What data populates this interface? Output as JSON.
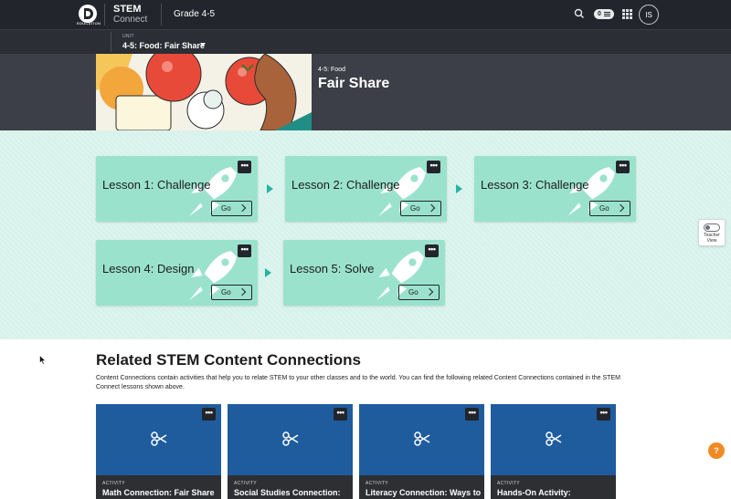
{
  "header": {
    "logo_text": "EDUCATION",
    "brand_primary": "STEM",
    "brand_secondary": "Connect",
    "grade": "Grade 4-5",
    "counter": "0",
    "avatar_initials": "IS"
  },
  "unit": {
    "label": "UNIT",
    "value": "4-5: Food: Fair Share"
  },
  "hero": {
    "kicker": "4-5: Food",
    "title": "Fair Share"
  },
  "lessons": [
    {
      "title": "Lesson 1: Challenge",
      "go": "Go"
    },
    {
      "title": "Lesson 2: Challenge",
      "go": "Go"
    },
    {
      "title": "Lesson 3: Challenge",
      "go": "Go"
    },
    {
      "title": "Lesson 4: Design",
      "go": "Go"
    },
    {
      "title": "Lesson 5: Solve",
      "go": "Go"
    }
  ],
  "teacher_view": {
    "line1": "Teacher",
    "line2": "View"
  },
  "related": {
    "title": "Related STEM Content Connections",
    "description": "Content Connections contain activities that help you to relate STEM to your other classes and to the world. You can find the following related Content Connections contained in the STEM Connect lessons shown above.",
    "cards": [
      {
        "kind": "ACTIVITY",
        "name": "Math Connection: Fair Share"
      },
      {
        "kind": "ACTIVITY",
        "name": "Social Studies Connection:"
      },
      {
        "kind": "ACTIVITY",
        "name": "Literacy Connection: Ways to"
      },
      {
        "kind": "ACTIVITY",
        "name": "Hands-On Activity:"
      }
    ]
  },
  "help_label": "?",
  "more_label": "•••",
  "colors": {
    "topbar": "#22252b",
    "hero": "#3c3f48",
    "lesson_bg": "#d7f2ea",
    "lesson_card": "#9be2cd",
    "arrow": "#25b3a6",
    "content_card": "#1f5c9e",
    "help": "#f08a24"
  }
}
